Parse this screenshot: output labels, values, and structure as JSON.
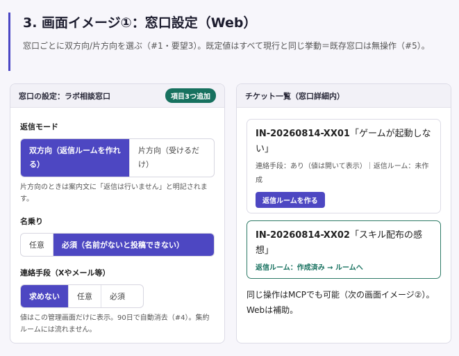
{
  "header": {
    "title": "3. 画面イメージ①：窓口設定（Web）",
    "subtitle": "窓口ごとに双方向/片方向を選ぶ（#1・要望3）。既定値はすべて現行と同じ挙動＝既存窓口は無操作（#5）。"
  },
  "settings": {
    "heading": "窓口の設定：ラボ相談窓口",
    "badge": "項目3つ追加",
    "reply_mode": {
      "label": "返信モード",
      "options": [
        "双方向（返信ルームを作れる）",
        "片方向（受けるだけ）"
      ],
      "selected": 0,
      "note": "片方向のときは案内文に「返信は行いません」と明記されます。"
    },
    "name": {
      "label": "名乗り",
      "options": [
        "任意",
        "必須（名前がないと投稿できない）"
      ],
      "selected": 1
    },
    "contact": {
      "label": "連絡手段（Xやメール等）",
      "options": [
        "求めない",
        "任意",
        "必須"
      ],
      "selected": 0,
      "note": "値はこの管理画面だけに表示。90日で自動消去（#4）。集約ルームには流れません。"
    }
  },
  "tickets": {
    "heading": "チケット一覧（窓口詳細内）",
    "items": [
      {
        "id": "IN-20260814-XX01",
        "title": "「ゲームが起動しない」",
        "meta": "連絡手段：あり（値は開いて表示）｜返信ルーム：未作成",
        "action": "返信ルームを作る"
      },
      {
        "id": "IN-20260814-XX02",
        "title": "「スキル配布の感想」",
        "status": "返信ルーム：作成済み → ルームへ"
      }
    ],
    "note": "同じ操作はMCPでも可能（次の画面イメージ②）。Webは補助。"
  }
}
